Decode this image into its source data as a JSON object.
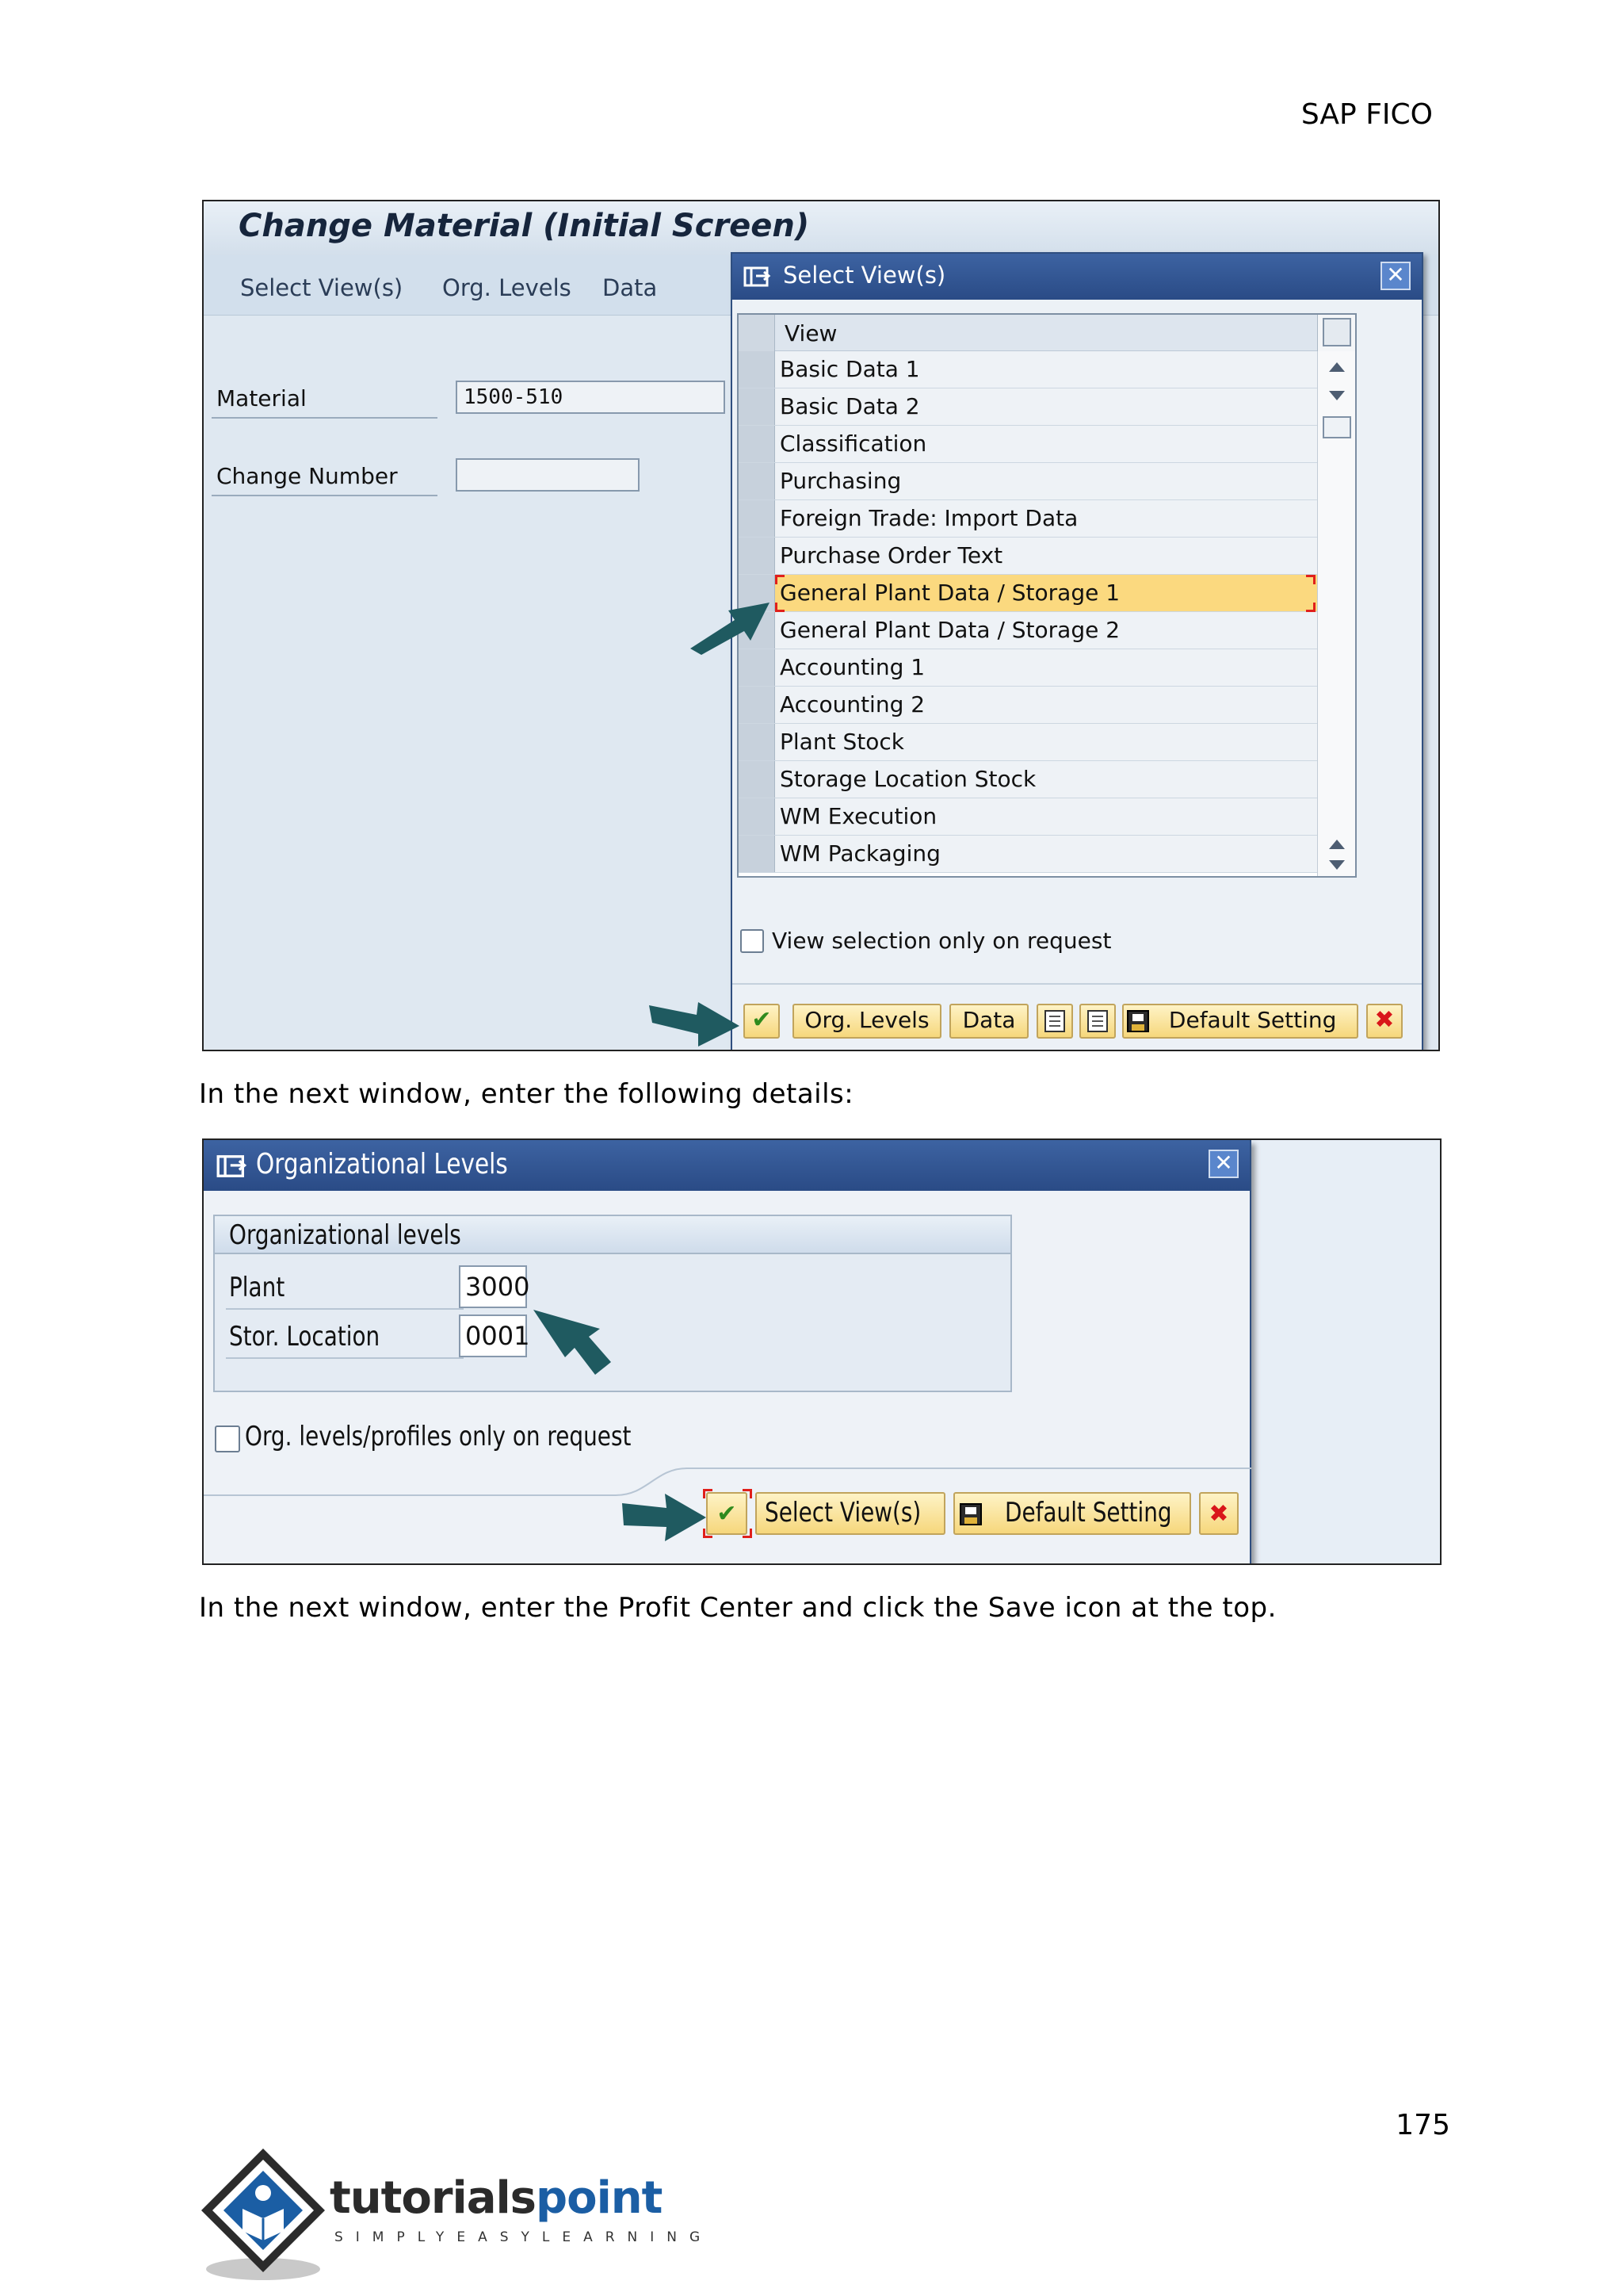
{
  "header": {
    "section": "SAP FICO"
  },
  "screen1": {
    "title": "Change Material (Initial Screen)",
    "menu": [
      "Select View(s)",
      "Org. Levels",
      "Data"
    ],
    "fields": {
      "material_label": "Material",
      "material_value": "1500-510",
      "change_number_label": "Change Number",
      "change_number_value": ""
    },
    "popup": {
      "title": "Select View(s)",
      "column_header": "View",
      "views": [
        "Basic Data 1",
        "Basic Data 2",
        "Classification",
        "Purchasing",
        "Foreign Trade: Import Data",
        "Purchase Order Text",
        "General Plant Data / Storage 1",
        "General Plant Data / Storage 2",
        "Accounting 1",
        "Accounting 2",
        "Plant Stock",
        "Storage Location Stock",
        "WM Execution",
        "WM Packaging"
      ],
      "selected_view": "General Plant Data / Storage 1",
      "checkbox_label": "View selection only on request",
      "buttons": {
        "org_levels": "Org. Levels",
        "data": "Data",
        "default_setting": "Default Setting"
      }
    }
  },
  "text1": "In the next window, enter the following details:",
  "screen2": {
    "title": "Organizational Levels",
    "group_title": "Organizational levels",
    "plant_label": "Plant",
    "plant_value": "3000",
    "stor_location_label": "Stor. Location",
    "stor_location_value": "0001",
    "checkbox_label": "Org. levels/profiles only on request",
    "buttons": {
      "select_views": "Select View(s)",
      "default_setting": "Default Setting"
    }
  },
  "text2": "In the next window, enter the Profit Center and click the Save icon at the top.",
  "page_number": "175",
  "logo": {
    "name_part1": "tutorials",
    "name_part2": "point",
    "tagline": "SIMPLYEASYLEARNING"
  },
  "colors": {
    "sap_titlebar": "#2f5290",
    "highlight_row": "#fbd97f",
    "arrow_teal": "#1f5a60",
    "button_yellow": "#f6d77c"
  }
}
